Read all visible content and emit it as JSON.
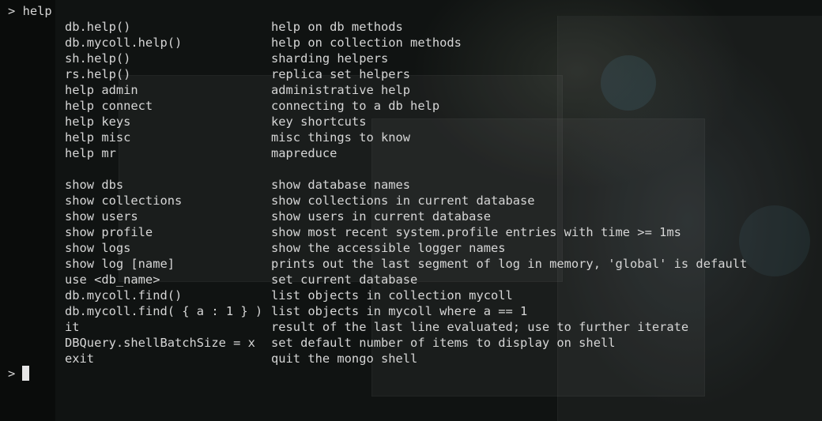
{
  "terminal": {
    "prompt_symbol": ">",
    "entered_command": "help",
    "groups": [
      {
        "rows": [
          {
            "cmd": "db.help()",
            "desc": "help on db methods"
          },
          {
            "cmd": "db.mycoll.help()",
            "desc": "help on collection methods"
          },
          {
            "cmd": "sh.help()",
            "desc": "sharding helpers"
          },
          {
            "cmd": "rs.help()",
            "desc": "replica set helpers"
          },
          {
            "cmd": "help admin",
            "desc": "administrative help"
          },
          {
            "cmd": "help connect",
            "desc": "connecting to a db help"
          },
          {
            "cmd": "help keys",
            "desc": "key shortcuts"
          },
          {
            "cmd": "help misc",
            "desc": "misc things to know"
          },
          {
            "cmd": "help mr",
            "desc": "mapreduce"
          }
        ]
      },
      {
        "rows": [
          {
            "cmd": "show dbs",
            "desc": "show database names"
          },
          {
            "cmd": "show collections",
            "desc": "show collections in current database"
          },
          {
            "cmd": "show users",
            "desc": "show users in current database"
          },
          {
            "cmd": "show profile",
            "desc": "show most recent system.profile entries with time >= 1ms"
          },
          {
            "cmd": "show logs",
            "desc": "show the accessible logger names"
          },
          {
            "cmd": "show log [name]",
            "desc": "prints out the last segment of log in memory, 'global' is default"
          },
          {
            "cmd": "use <db_name>",
            "desc": "set current database"
          },
          {
            "cmd": "db.mycoll.find()",
            "desc": "list objects in collection mycoll"
          },
          {
            "cmd": "db.mycoll.find( { a : 1 } )",
            "desc": "list objects in mycoll where a == 1"
          },
          {
            "cmd": "it",
            "desc": "result of the last line evaluated; use to further iterate"
          },
          {
            "cmd": "DBQuery.shellBatchSize = x",
            "desc": "set default number of items to display on shell"
          },
          {
            "cmd": "exit",
            "desc": "quit the mongo shell"
          }
        ]
      }
    ]
  }
}
